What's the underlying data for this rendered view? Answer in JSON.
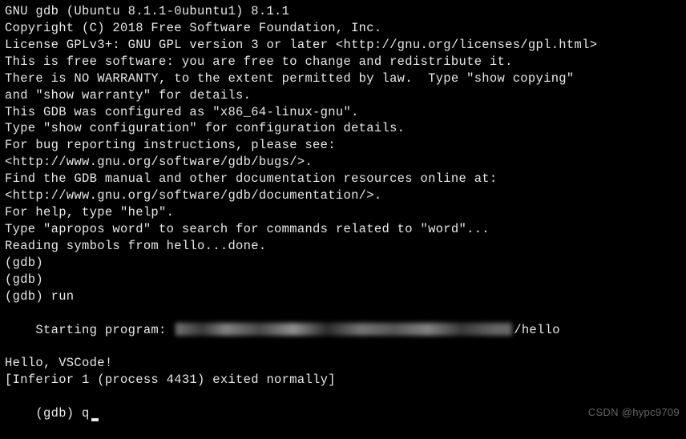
{
  "terminal": {
    "lines": [
      "GNU gdb (Ubuntu 8.1.1-0ubuntu1) 8.1.1",
      "Copyright (C) 2018 Free Software Foundation, Inc.",
      "License GPLv3+: GNU GPL version 3 or later <http://gnu.org/licenses/gpl.html>",
      "This is free software: you are free to change and redistribute it.",
      "There is NO WARRANTY, to the extent permitted by law.  Type \"show copying\"",
      "and \"show warranty\" for details.",
      "This GDB was configured as \"x86_64-linux-gnu\".",
      "Type \"show configuration\" for configuration details.",
      "For bug reporting instructions, please see:",
      "<http://www.gnu.org/software/gdb/bugs/>.",
      "Find the GDB manual and other documentation resources online at:",
      "<http://www.gnu.org/software/gdb/documentation/>.",
      "For help, type \"help\".",
      "Type \"apropos word\" to search for commands related to \"word\"...",
      "Reading symbols from hello...done.",
      "(gdb) ",
      "(gdb) ",
      "(gdb) run"
    ],
    "starting_prefix": "Starting program: ",
    "starting_suffix": "/hello",
    "output_lines": [
      "Hello, VSCode!",
      "[Inferior 1 (process 4431) exited normally]"
    ],
    "final_prompt": "(gdb) q"
  },
  "watermark": "CSDN @hypc9709"
}
